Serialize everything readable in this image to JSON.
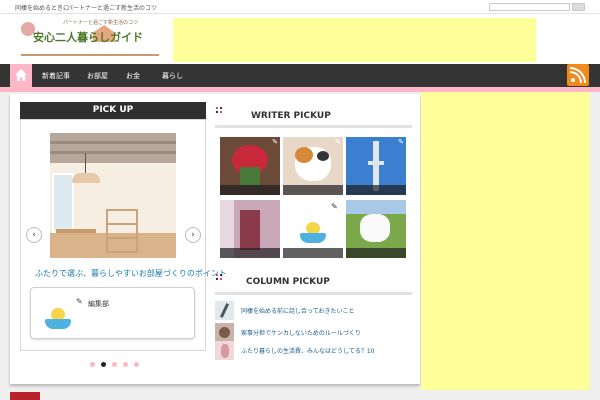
{
  "top_bar": {
    "breadcrumb_1": "同棲を始めるときに",
    "separator": "-",
    "breadcrumb_2": "パートナーと過ごす新生活のコツ"
  },
  "header": {
    "site_tagline": "パートナーと過ごす新生活のコツ",
    "site_title": "安心二人暮らしガイド",
    "ad_color": "#ffff99"
  },
  "nav": {
    "home_icon": "home-icon",
    "items": [
      {
        "label": "新着記事"
      },
      {
        "label": "お部屋"
      },
      {
        "label": "お金"
      },
      {
        "label": "暮らし"
      }
    ],
    "rss_icon": "rss-icon"
  },
  "pickup": {
    "heading": "PICK UP",
    "caption": "ふたりで選ぶ、暮らしやすいお部屋づくりのポイント",
    "author_label": "編集部",
    "prev_arrow": "‹",
    "next_arrow": "›",
    "slide_count": 5,
    "active_slide": 2
  },
  "writer_pickup": {
    "heading": "WRITER PICKUP",
    "thumbnails": [
      {
        "name": "flower-photo"
      },
      {
        "name": "cat-photo"
      },
      {
        "name": "tower-photo"
      },
      {
        "name": "hallway-photo"
      },
      {
        "name": "chick-illustration"
      },
      {
        "name": "white-dog-photo"
      }
    ]
  },
  "column_pickup": {
    "heading": "COLUMN PICKUP",
    "items": [
      {
        "title": "同棲を始める前に話し合っておきたいこと"
      },
      {
        "title": "家事分担でケンカしないためのルールづくり"
      },
      {
        "title": "ふたり暮らしの生活費、みんなはどうしてる？10"
      }
    ]
  },
  "colors": {
    "nav_bg": "#343434",
    "accent_pink": "#ffb6c8",
    "ad_yellow": "#ffff99",
    "rss_orange": "#f08a1c",
    "link_blue": "#1a7ab0"
  }
}
